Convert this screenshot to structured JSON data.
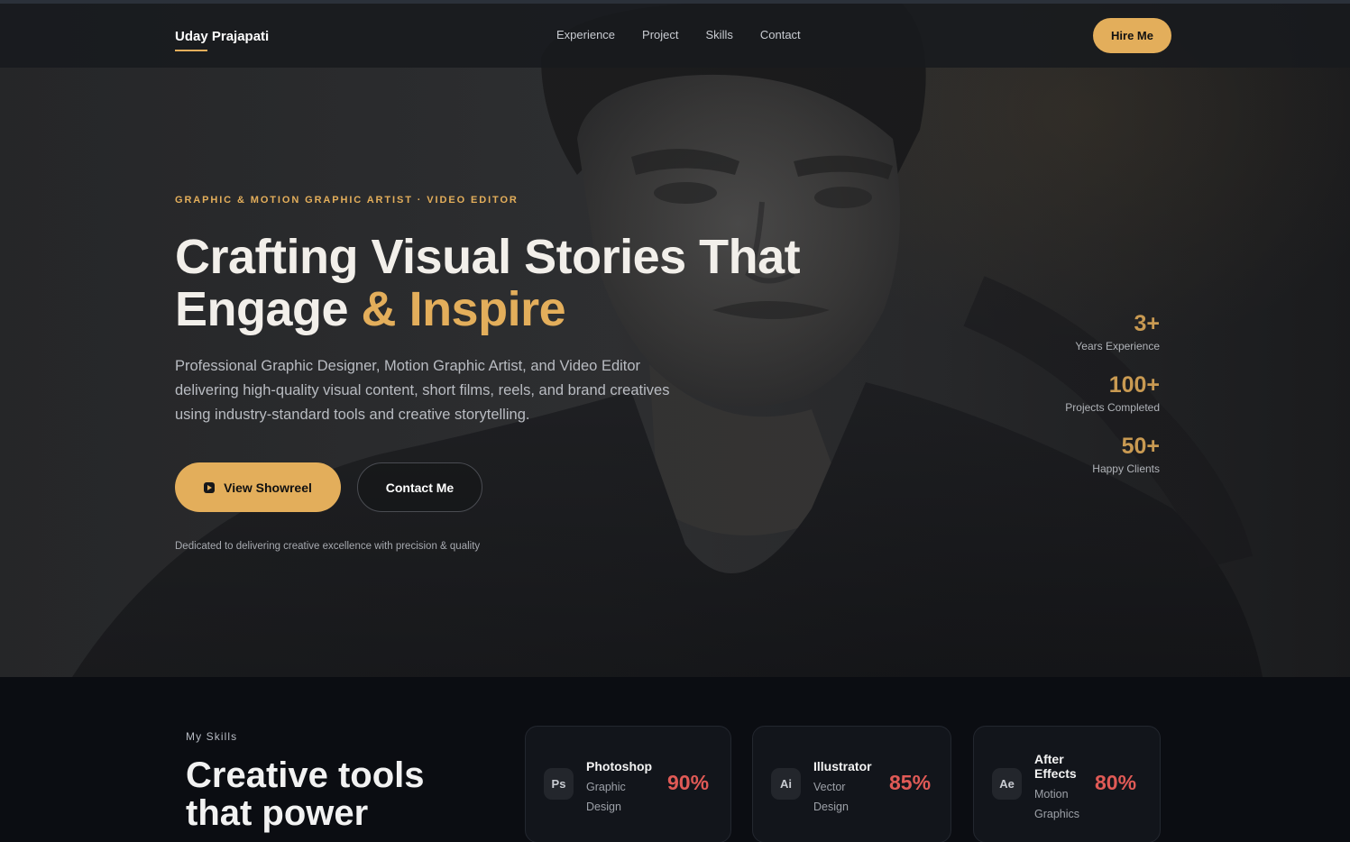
{
  "nav": {
    "brand": "Uday Prajapati",
    "links": [
      "Experience",
      "Project",
      "Skills",
      "Contact"
    ],
    "cta": "Hire Me"
  },
  "hero": {
    "eyebrow": "GRAPHIC & MOTION GRAPHIC ARTIST · VIDEO EDITOR",
    "headline_line1": "Crafting Visual Stories That",
    "headline_line2_a": "Engage",
    "headline_line2_b": " & ",
    "headline_line2_c": "Inspire",
    "lead": "Professional Graphic Designer, Motion Graphic Artist, and Video Editor delivering high-quality visual content, short films, reels, and brand creatives using industry-standard tools and creative storytelling.",
    "primary_button": "View Showreel",
    "primary_button_icon": "play-icon",
    "secondary_button": "Contact Me",
    "tagline": "Dedicated to delivering creative excellence with precision & quality"
  },
  "stats": [
    {
      "value": "3+",
      "label": "Years Experience"
    },
    {
      "value": "100+",
      "label": "Projects Completed"
    },
    {
      "value": "50+",
      "label": "Happy Clients"
    }
  ],
  "skills": {
    "eyebrow": "My Skills",
    "title_line1": "Creative tools",
    "title_line2": "that power",
    "cards": [
      {
        "icon": "Ps",
        "name_line1": "Photoshop",
        "name_line2": "",
        "desc_line1": "Graphic",
        "desc_line2": "Design",
        "percent": "90%"
      },
      {
        "icon": "Ai",
        "name_line1": "Illustrator",
        "name_line2": "",
        "desc_line1": "Vector",
        "desc_line2": "Design",
        "percent": "85%"
      },
      {
        "icon": "Ae",
        "name_line1": "After",
        "name_line2": "Effects",
        "desc_line1": "Motion",
        "desc_line2": "Graphics",
        "percent": "80%"
      }
    ]
  },
  "colors": {
    "accent": "#e3ae5b",
    "stat": "#c99a52",
    "percent": "#e05a56",
    "background": "#0b0d12"
  }
}
